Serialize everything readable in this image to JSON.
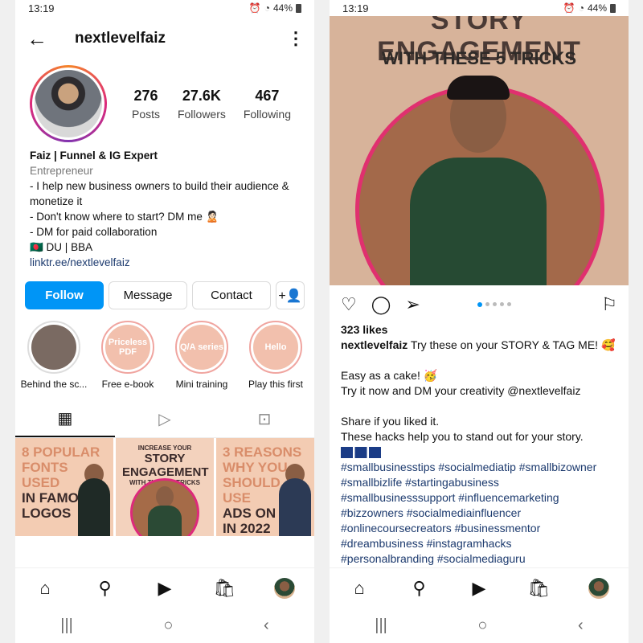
{
  "status": {
    "time": "13:19",
    "battery": "44%"
  },
  "profile": {
    "username": "nextlevelfaiz",
    "stats": [
      {
        "num": "276",
        "label": "Posts"
      },
      {
        "num": "27.6K",
        "label": "Followers"
      },
      {
        "num": "467",
        "label": "Following"
      }
    ],
    "bio": {
      "name": "Faiz | Funnel & IG Expert",
      "category": "Entrepreneur",
      "line1": "- I help new business owners to build their audience & monetize it",
      "line2": "- Don't know where to start? DM me 🙎🏻",
      "line3": "- DM for paid collaboration",
      "line4": "🇧🇩 DU | BBA",
      "link": "linktr.ee/nextlevelfaiz"
    },
    "buttons": {
      "follow": "Follow",
      "message": "Message",
      "contact": "Contact"
    },
    "highlights": [
      {
        "label": "Behind the sc...",
        "cover_text": "",
        "color": "#7a6a62"
      },
      {
        "label": "Free e-book",
        "cover_text": "Priceless PDF",
        "color": "#f2c0ad"
      },
      {
        "label": "Mini training",
        "cover_text": "Q/A series",
        "color": "#f2c0ad"
      },
      {
        "label": "Play this first",
        "cover_text": "Hello",
        "color": "#f2c0ad"
      }
    ],
    "grid": [
      {
        "line1": "8 POPULAR",
        "line2": "FONTS USED",
        "line3": "IN FAMOUS",
        "line4": "LOGOS"
      },
      {
        "small_top": "INCREASE YOUR",
        "big": "STORY ENGAGEMENT",
        "small_bottom": "WITH THESE 5 TRICKS"
      },
      {
        "line1": "3 REASONS",
        "line2": "WHY YOU",
        "line3": "SHOULD USE",
        "line4": "ADS ON IG",
        "line5": "IN 2022"
      }
    ]
  },
  "post": {
    "image_title": "STORY ENGAGEMENT",
    "image_subtitle": "WITH THESE 5 TRICKS",
    "likes": "323 likes",
    "username": "nextlevelfaiz",
    "caption_first": "Try these on your STORY & TAG ME! 🥰",
    "p1": "Easy as a cake! 🥳",
    "p2": "Try it now and DM your creativity @nextlevelfaiz",
    "p3": "Share if you liked it.",
    "p4": "These hacks help you to stand out for your story.",
    "hashtags": [
      "#smallbusinesstips #socialmediatip #smallbizowner",
      "#smallbizlife #startingabusiness",
      "#smallbusinesssupport #influencemarketing",
      "#bizzowners #socialmediainfluencer",
      "#onlinecoursecreators #businessmentor",
      "#dreambusiness #instagramhacks",
      "#personalbranding #socialmediaguru"
    ]
  }
}
